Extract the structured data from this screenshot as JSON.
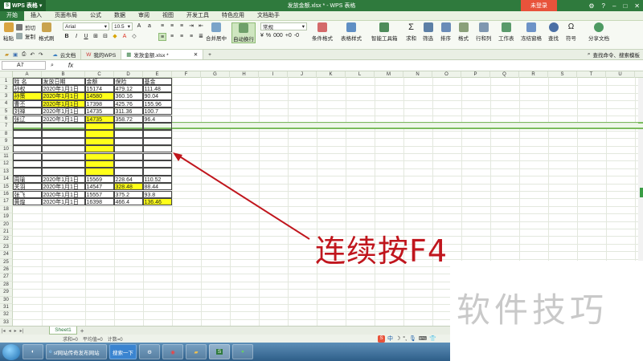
{
  "titlebar": {
    "app_name": "WPS 表格",
    "doc_title": "发放金额.xlsx * - WPS 表格",
    "login": "未登录"
  },
  "menu": [
    "开始",
    "插入",
    "页面布局",
    "公式",
    "数据",
    "审阅",
    "视图",
    "开发工具",
    "特色应用",
    "文档助手"
  ],
  "ribbon": {
    "paste": "粘贴",
    "cut": "剪切",
    "copy": "复制",
    "format_painter": "格式刷",
    "font_name": "Arial",
    "font_size": "10.5",
    "merge_center": "合并居中",
    "auto_wrap": "自动换行",
    "number_format": "常规",
    "cond_format": "条件格式",
    "table_style": "表格样式",
    "smart_toolbox": "智能工具箱",
    "sum": "求和",
    "filter": "筛选",
    "sort": "排序",
    "format": "格式",
    "row_col": "行和列",
    "worksheet": "工作表",
    "freeze": "冻结窗格",
    "find": "查找",
    "symbol": "符号",
    "share": "分享文档"
  },
  "tabs": {
    "cloud": "云文档",
    "my_wps": "我的WPS",
    "active_doc": "发放金额.xlsx *",
    "search_cmd": "查找命令、搜索模板"
  },
  "formula": {
    "namebox": "A7",
    "fx": "fx"
  },
  "columns": [
    "A",
    "B",
    "C",
    "D",
    "E",
    "F",
    "G",
    "H",
    "I",
    "J",
    "K",
    "L",
    "M",
    "N",
    "O",
    "P",
    "Q",
    "R",
    "S",
    "T",
    "U"
  ],
  "rows": [
    "1",
    "2",
    "3",
    "4",
    "5",
    "6",
    "7",
    "8",
    "9",
    "10",
    "11",
    "12",
    "13",
    "14",
    "15",
    "16",
    "17",
    "18",
    "19",
    "20",
    "21",
    "22",
    "23",
    "24",
    "25",
    "26",
    "27",
    "28",
    "29",
    "30",
    "31",
    "32",
    "33"
  ],
  "table": {
    "headers": [
      "姓 名",
      "发放日期",
      "金额",
      "保险",
      "基金"
    ],
    "rows": [
      {
        "r": 2,
        "cells": [
          "孙权",
          "2020年1月1日",
          "15174",
          "479.12",
          "111.48"
        ]
      },
      {
        "r": 3,
        "cells": [
          "孙策",
          "2020年1月1日",
          "14580",
          "360.16",
          "90.04"
        ]
      },
      {
        "r": 4,
        "cells": [
          "曹丕",
          "2020年1月1日",
          "17398",
          "425.76",
          "155.96"
        ]
      },
      {
        "r": 5,
        "cells": [
          "刘禅",
          "2020年1月1日",
          "14735",
          "311.36",
          "100.7"
        ]
      },
      {
        "r": 6,
        "cells": [
          "张辽",
          "2020年1月1日",
          "14735",
          "358.72",
          "96.4"
        ]
      },
      {
        "r": 14,
        "cells": [
          "周瑜",
          "2020年1月1日",
          "15569",
          "228.64",
          "110.52"
        ]
      },
      {
        "r": 15,
        "cells": [
          "关羽",
          "2020年1月1日",
          "14547",
          "328.48",
          "88.44"
        ]
      },
      {
        "r": 16,
        "cells": [
          "张飞",
          "2020年1月1日",
          "15557",
          "375.2",
          "93.8"
        ]
      },
      {
        "r": 17,
        "cells": [
          "黄煌",
          "2020年1月1日",
          "16398",
          "466.4",
          "136.46"
        ]
      }
    ]
  },
  "annotation": "连续按F4",
  "watermark": "软件技巧",
  "sheet": {
    "name": "Sheet1"
  },
  "status": {
    "sum": "求和=0",
    "avg": "平均值=0",
    "count": "计数=0",
    "ime": "中"
  },
  "taskbar": {
    "browser_item": "sf网站传奇发布网站",
    "search": "搜索一下"
  },
  "colors": {
    "accent": "#2f7a3d",
    "highlight": "#ffff1a",
    "annotation": "#c0161d"
  }
}
